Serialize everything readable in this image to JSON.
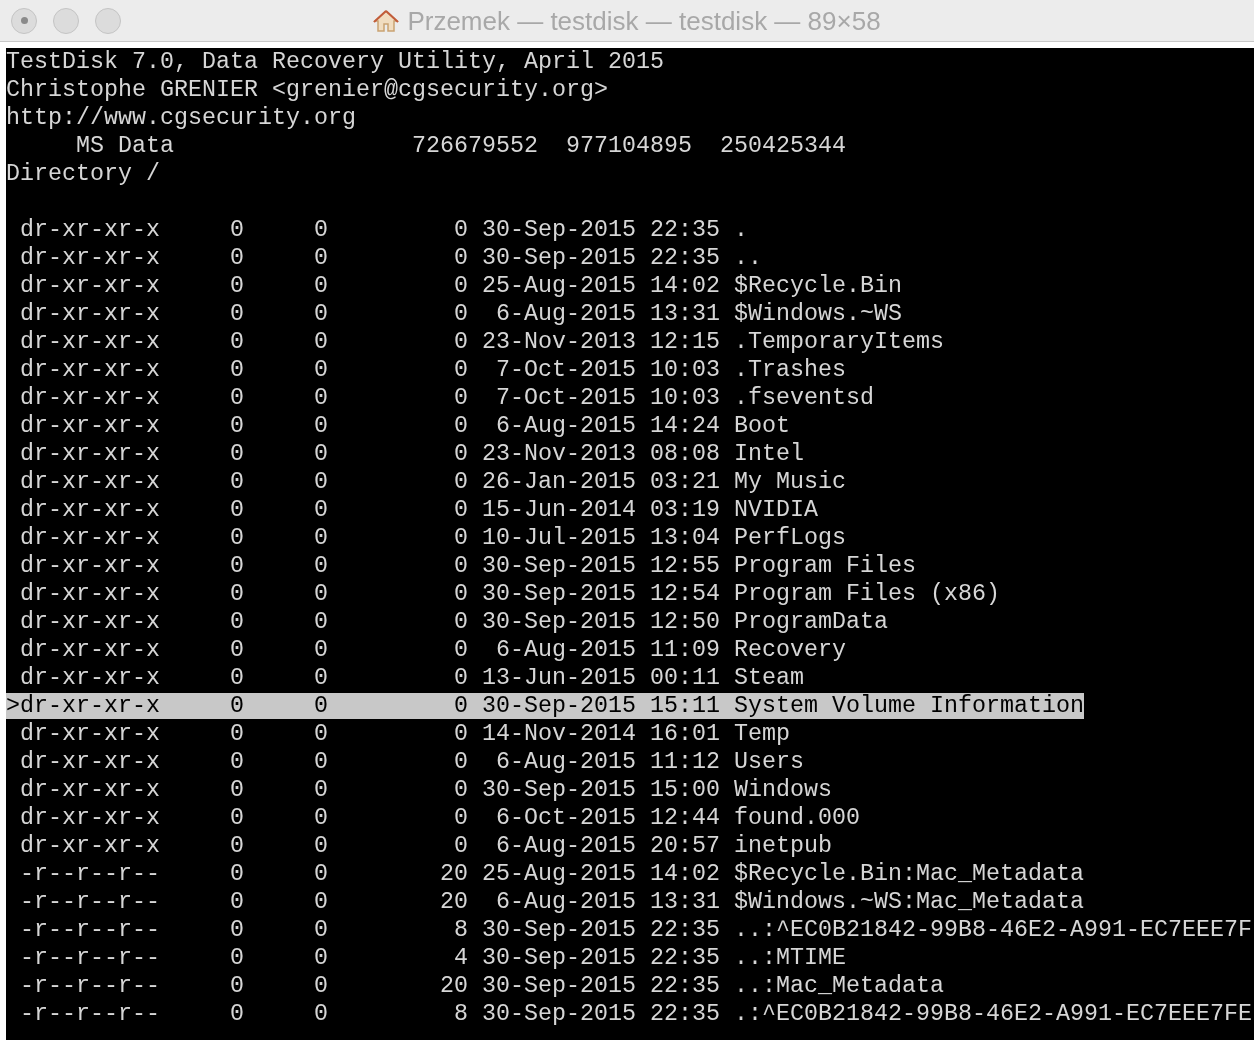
{
  "window": {
    "title": "Przemek — testdisk — testdisk — 89×58"
  },
  "header": [
    "TestDisk 7.0, Data Recovery Utility, April 2015",
    "Christophe GRENIER <grenier@cgsecurity.org>",
    "http://www.cgsecurity.org",
    "     MS Data                 726679552  977104895  250425344",
    "Directory /"
  ],
  "rows": [
    {
      "text": " dr-xr-xr-x     0     0         0 30-Sep-2015 22:35 .",
      "selected": false
    },
    {
      "text": " dr-xr-xr-x     0     0         0 30-Sep-2015 22:35 ..",
      "selected": false
    },
    {
      "text": " dr-xr-xr-x     0     0         0 25-Aug-2015 14:02 $Recycle.Bin",
      "selected": false
    },
    {
      "text": " dr-xr-xr-x     0     0         0  6-Aug-2015 13:31 $Windows.~WS",
      "selected": false
    },
    {
      "text": " dr-xr-xr-x     0     0         0 23-Nov-2013 12:15 .TemporaryItems",
      "selected": false
    },
    {
      "text": " dr-xr-xr-x     0     0         0  7-Oct-2015 10:03 .Trashes",
      "selected": false
    },
    {
      "text": " dr-xr-xr-x     0     0         0  7-Oct-2015 10:03 .fseventsd",
      "selected": false
    },
    {
      "text": " dr-xr-xr-x     0     0         0  6-Aug-2015 14:24 Boot",
      "selected": false
    },
    {
      "text": " dr-xr-xr-x     0     0         0 23-Nov-2013 08:08 Intel",
      "selected": false
    },
    {
      "text": " dr-xr-xr-x     0     0         0 26-Jan-2015 03:21 My Music",
      "selected": false
    },
    {
      "text": " dr-xr-xr-x     0     0         0 15-Jun-2014 03:19 NVIDIA",
      "selected": false
    },
    {
      "text": " dr-xr-xr-x     0     0         0 10-Jul-2015 13:04 PerfLogs",
      "selected": false
    },
    {
      "text": " dr-xr-xr-x     0     0         0 30-Sep-2015 12:55 Program Files",
      "selected": false
    },
    {
      "text": " dr-xr-xr-x     0     0         0 30-Sep-2015 12:54 Program Files (x86)",
      "selected": false
    },
    {
      "text": " dr-xr-xr-x     0     0         0 30-Sep-2015 12:50 ProgramData",
      "selected": false
    },
    {
      "text": " dr-xr-xr-x     0     0         0  6-Aug-2015 11:09 Recovery",
      "selected": false
    },
    {
      "text": " dr-xr-xr-x     0     0         0 13-Jun-2015 00:11 Steam",
      "selected": false
    },
    {
      "text": ">dr-xr-xr-x     0     0         0 30-Sep-2015 15:11 System Volume Information",
      "selected": true
    },
    {
      "text": " dr-xr-xr-x     0     0         0 14-Nov-2014 16:01 Temp",
      "selected": false
    },
    {
      "text": " dr-xr-xr-x     0     0         0  6-Aug-2015 11:12 Users",
      "selected": false
    },
    {
      "text": " dr-xr-xr-x     0     0         0 30-Sep-2015 15:00 Windows",
      "selected": false
    },
    {
      "text": " dr-xr-xr-x     0     0         0  6-Oct-2015 12:44 found.000",
      "selected": false
    },
    {
      "text": " dr-xr-xr-x     0     0         0  6-Aug-2015 20:57 inetpub",
      "selected": false
    },
    {
      "text": " -r--r--r--     0     0        20 25-Aug-2015 14:02 $Recycle.Bin:Mac_Metadata",
      "selected": false
    },
    {
      "text": " -r--r--r--     0     0        20  6-Aug-2015 13:31 $Windows.~WS:Mac_Metadata",
      "selected": false
    },
    {
      "text": " -r--r--r--     0     0         8 30-Sep-2015 22:35 ..:^EC0B21842-99B8-46E2-A991-EC7EEE7F",
      "selected": false
    },
    {
      "text": " -r--r--r--     0     0         4 30-Sep-2015 22:35 ..:MTIME",
      "selected": false
    },
    {
      "text": " -r--r--r--     0     0        20 30-Sep-2015 22:35 ..:Mac_Metadata",
      "selected": false
    },
    {
      "text": " -r--r--r--     0     0         8 30-Sep-2015 22:35 .:^EC0B21842-99B8-46E2-A991-EC7EEE7FE",
      "selected": false
    }
  ]
}
